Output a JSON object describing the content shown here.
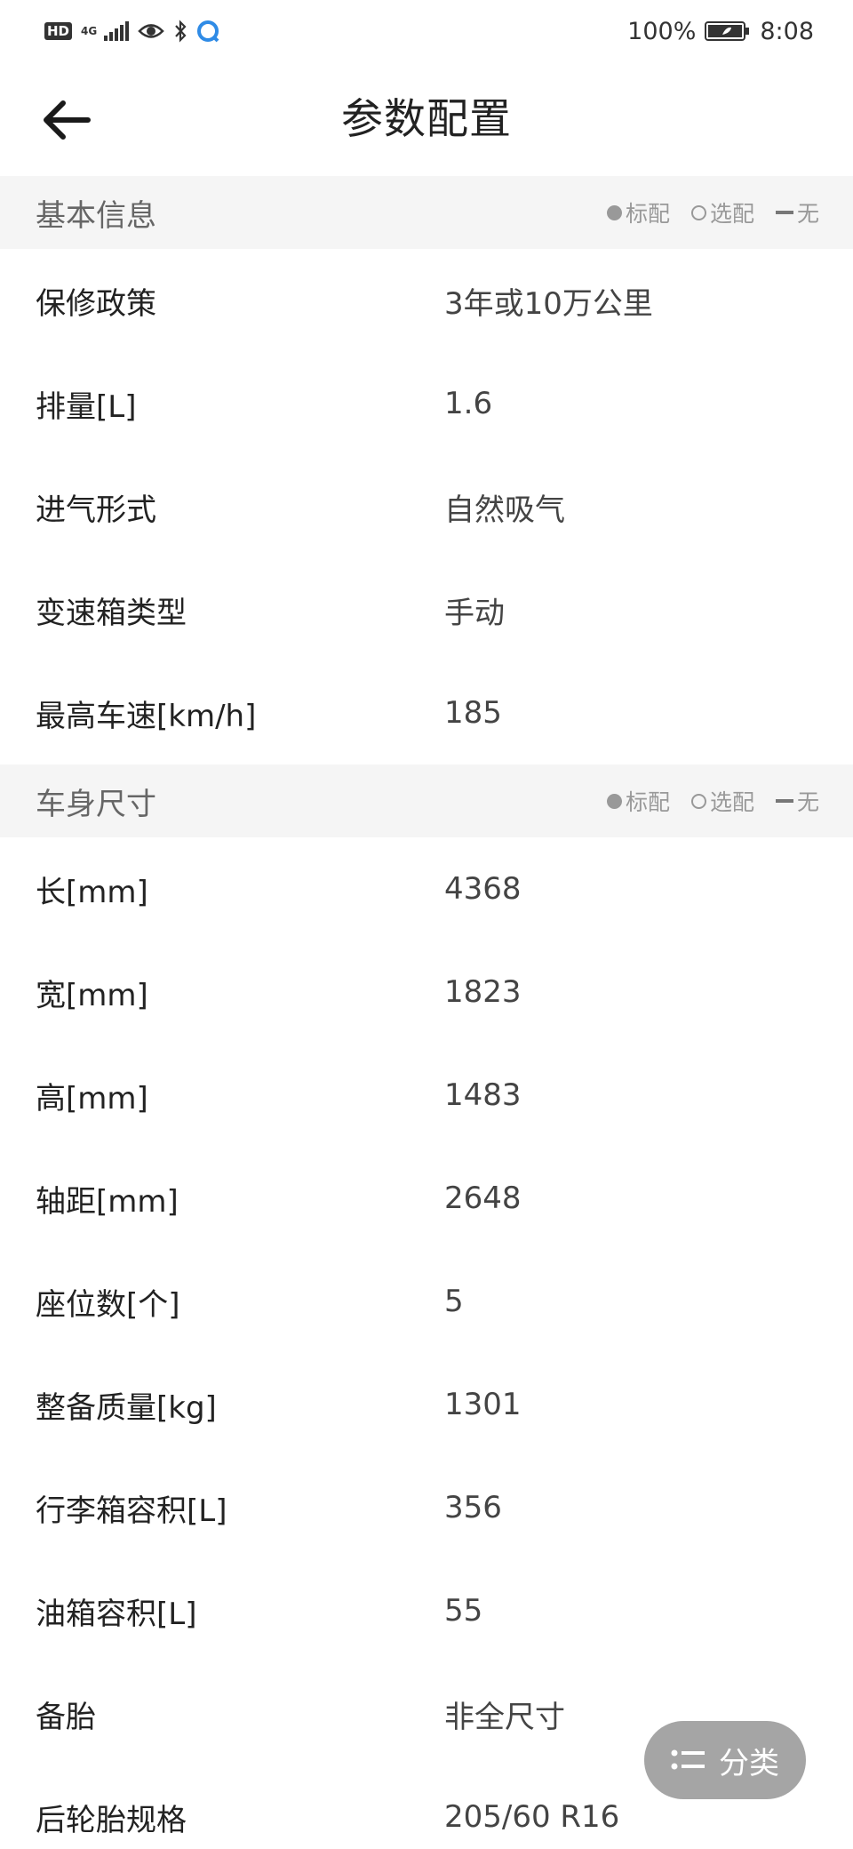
{
  "status_bar": {
    "hd": "HD",
    "network": "4G",
    "battery_pct": "100%",
    "time": "8:08"
  },
  "header": {
    "title": "参数配置"
  },
  "legend": {
    "standard": "标配",
    "optional": "选配",
    "none": "无"
  },
  "sections": [
    {
      "title": "基本信息",
      "rows": [
        {
          "label": "保修政策",
          "value": "3年或10万公里"
        },
        {
          "label": "排量[L]",
          "value": "1.6"
        },
        {
          "label": "进气形式",
          "value": "自然吸气"
        },
        {
          "label": "变速箱类型",
          "value": "手动"
        },
        {
          "label": "最高车速[km/h]",
          "value": "185"
        }
      ]
    },
    {
      "title": "车身尺寸",
      "rows": [
        {
          "label": "长[mm]",
          "value": "4368"
        },
        {
          "label": "宽[mm]",
          "value": "1823"
        },
        {
          "label": "高[mm]",
          "value": "1483"
        },
        {
          "label": "轴距[mm]",
          "value": "2648"
        },
        {
          "label": "座位数[个]",
          "value": "5"
        },
        {
          "label": "整备质量[kg]",
          "value": "1301"
        },
        {
          "label": "行李箱容积[L]",
          "value": "356"
        },
        {
          "label": "油箱容积[L]",
          "value": "55"
        },
        {
          "label": "备胎",
          "value": "非全尺寸"
        },
        {
          "label": "后轮胎规格",
          "value": "205/60 R16"
        }
      ]
    }
  ],
  "fab": {
    "label": "分类",
    "icon": "list-icon"
  },
  "colors": {
    "section_bg": "#f5f5f5",
    "fab_bg": "#a5a5a5",
    "text": "#222222"
  }
}
